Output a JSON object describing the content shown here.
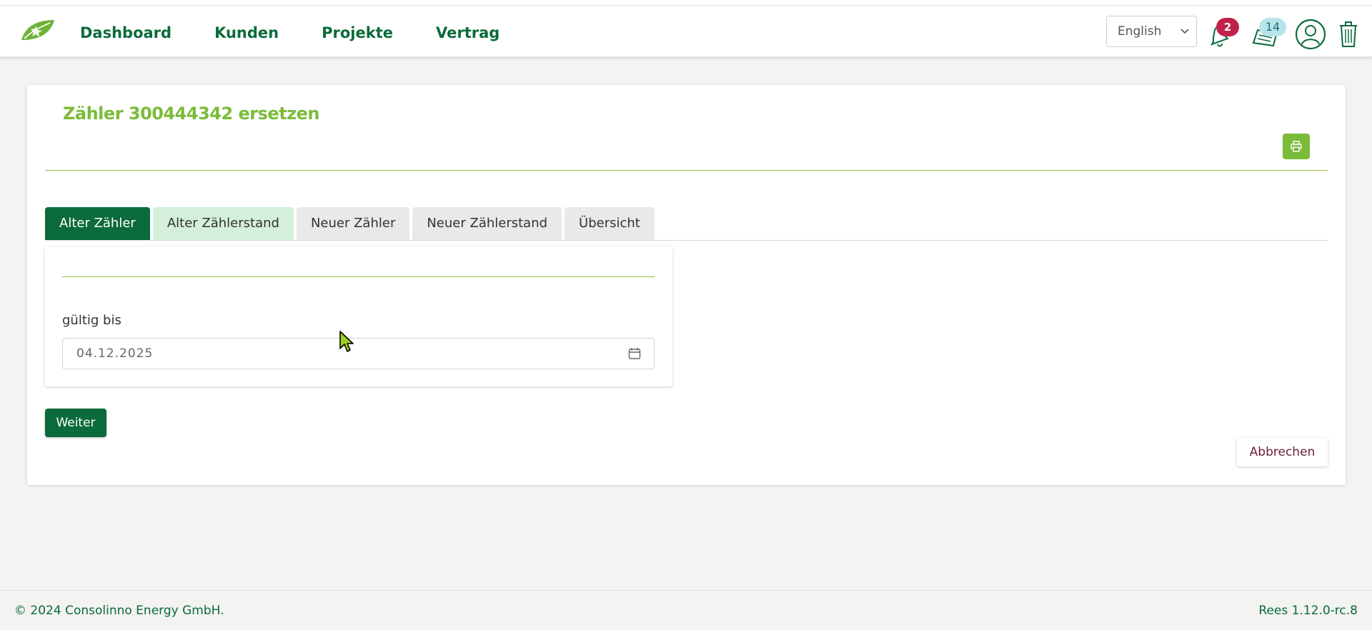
{
  "header": {
    "nav": [
      "Dashboard",
      "Kunden",
      "Projekte",
      "Vertrag"
    ],
    "language": "English",
    "notifications_count": "2",
    "news_count": "14"
  },
  "main": {
    "title": "Zähler 300444342 ersetzen",
    "tabs": [
      "Alter Zähler",
      "Alter Zählerstand",
      "Neuer Zähler",
      "Neuer Zählerstand",
      "Übersicht"
    ],
    "active_tab": "Alter Zähler",
    "field": {
      "label": "gültig bis",
      "value": "04.12.2025"
    },
    "next_button": "Weiter",
    "cancel_button": "Abbrechen"
  },
  "footer": {
    "copyright": "© 2024 Consolinno Energy GmbH.",
    "version": "Rees 1.12.0-rc.8"
  },
  "colors": {
    "brand_dark_green": "#0b6b3a",
    "brand_light_green": "#7bbb3a",
    "badge_red": "#c0224a",
    "badge_teal": "#b7e4ea",
    "cancel_text": "#6a1e3a"
  },
  "icons": [
    "logo-leaf-icon",
    "chevron-down-icon",
    "bell-icon",
    "news-icon",
    "user-icon",
    "trash-icon",
    "print-icon",
    "calendar-icon"
  ]
}
